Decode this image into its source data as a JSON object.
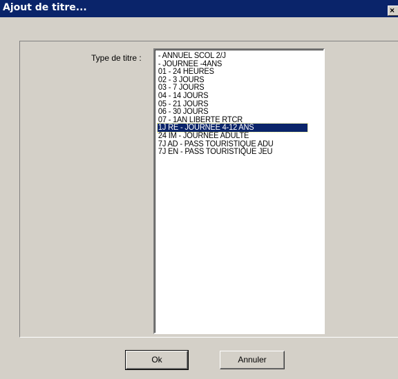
{
  "window": {
    "title": "Ajout de titre...",
    "close_glyph": "×"
  },
  "form": {
    "type_label": "Type de titre :"
  },
  "titles": {
    "selected_index": 11,
    "items": [
      " - ANNUEL SCOL 2/J",
      " - JOURNEE -4ANS",
      "01 - 24 HEURES",
      "02 - 3 JOURS",
      "03 - 7 JOURS",
      "04 - 14 JOURS",
      "05 - 21 JOURS",
      "06 - 30 JOURS",
      "07 - 1AN LIBERTE RTCR",
      "1J RE - JOURNEE 4-12 ANS",
      "24 IM - JOURNEE ADULTE",
      "7J AD - PASS TOURISTIQUE ADU",
      "7J EN - PASS TOURISTIQUE JEU"
    ]
  },
  "buttons": {
    "ok_label": "Ok",
    "cancel_label": "Annuler"
  },
  "colors": {
    "face": "#d4d0c8",
    "titlebar": "#0a246a",
    "selection": "#0a246a"
  }
}
